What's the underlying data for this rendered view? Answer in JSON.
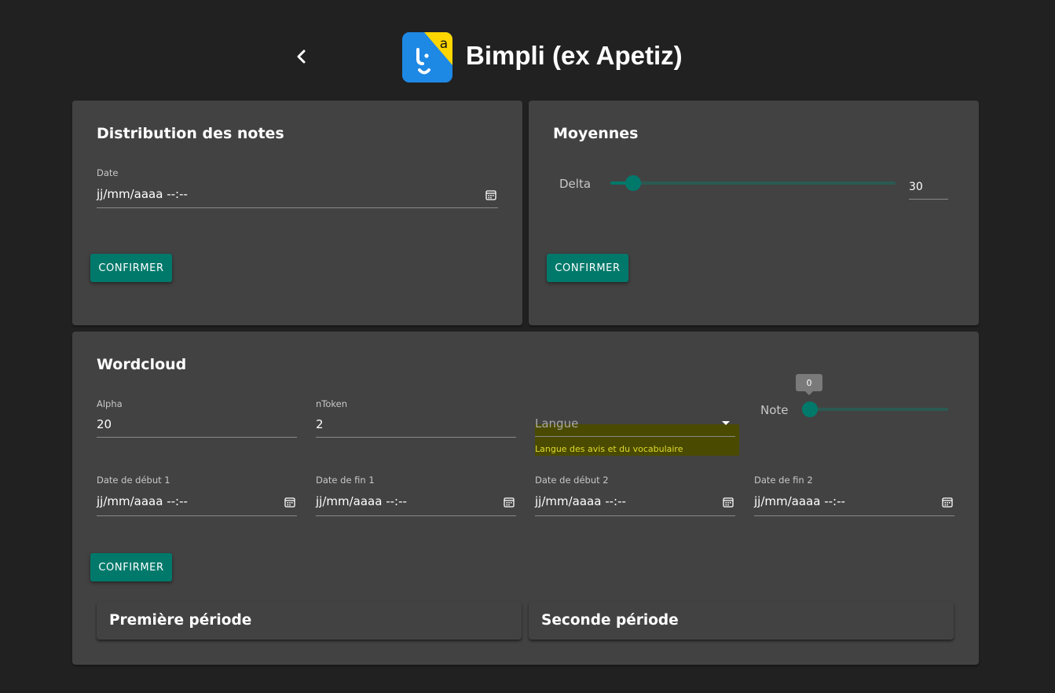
{
  "header": {
    "title": "Bimpli (ex Apetiz)",
    "back_icon": "chevron-left-icon",
    "logo_letter": "a",
    "logo_colors": {
      "blue": "#1e88e5",
      "yellow": "#ffd600"
    }
  },
  "colors": {
    "accent": "#00796b",
    "card_bg": "#424242",
    "page_bg": "#212121",
    "highlight_bg": "#4a4a00",
    "highlight_text": "#e0dc30"
  },
  "distribution": {
    "title": "Distribution des notes",
    "date_label": "Date",
    "date_value": "jj/mm/aaaa  --:--",
    "confirm_label": "CONFIRMER"
  },
  "moyennes": {
    "title": "Moyennes",
    "delta_label": "Delta",
    "delta_value": "30",
    "delta_fraction": 0.08,
    "confirm_label": "CONFIRMER"
  },
  "wordcloud": {
    "title": "Wordcloud",
    "alpha_label": "Alpha",
    "alpha_value": "20",
    "ntoken_label": "nToken",
    "ntoken_value": "2",
    "langue_placeholder": "Langue",
    "langue_hint": "Langue des avis et du vocabulaire",
    "note_label": "Note",
    "note_value": "0",
    "date_debut_1_label": "Date de début 1",
    "date_debut_1_value": "jj/mm/aaaa  --:--",
    "date_fin_1_label": "Date de fin 1",
    "date_fin_1_value": "jj/mm/aaaa  --:--",
    "date_debut_2_label": "Date de début 2",
    "date_debut_2_value": "jj/mm/aaaa  --:--",
    "date_fin_2_label": "Date de fin 2",
    "date_fin_2_value": "jj/mm/aaaa  --:--",
    "confirm_label": "CONFIRMER",
    "first_period_title": "Première période",
    "second_period_title": "Seconde période"
  }
}
